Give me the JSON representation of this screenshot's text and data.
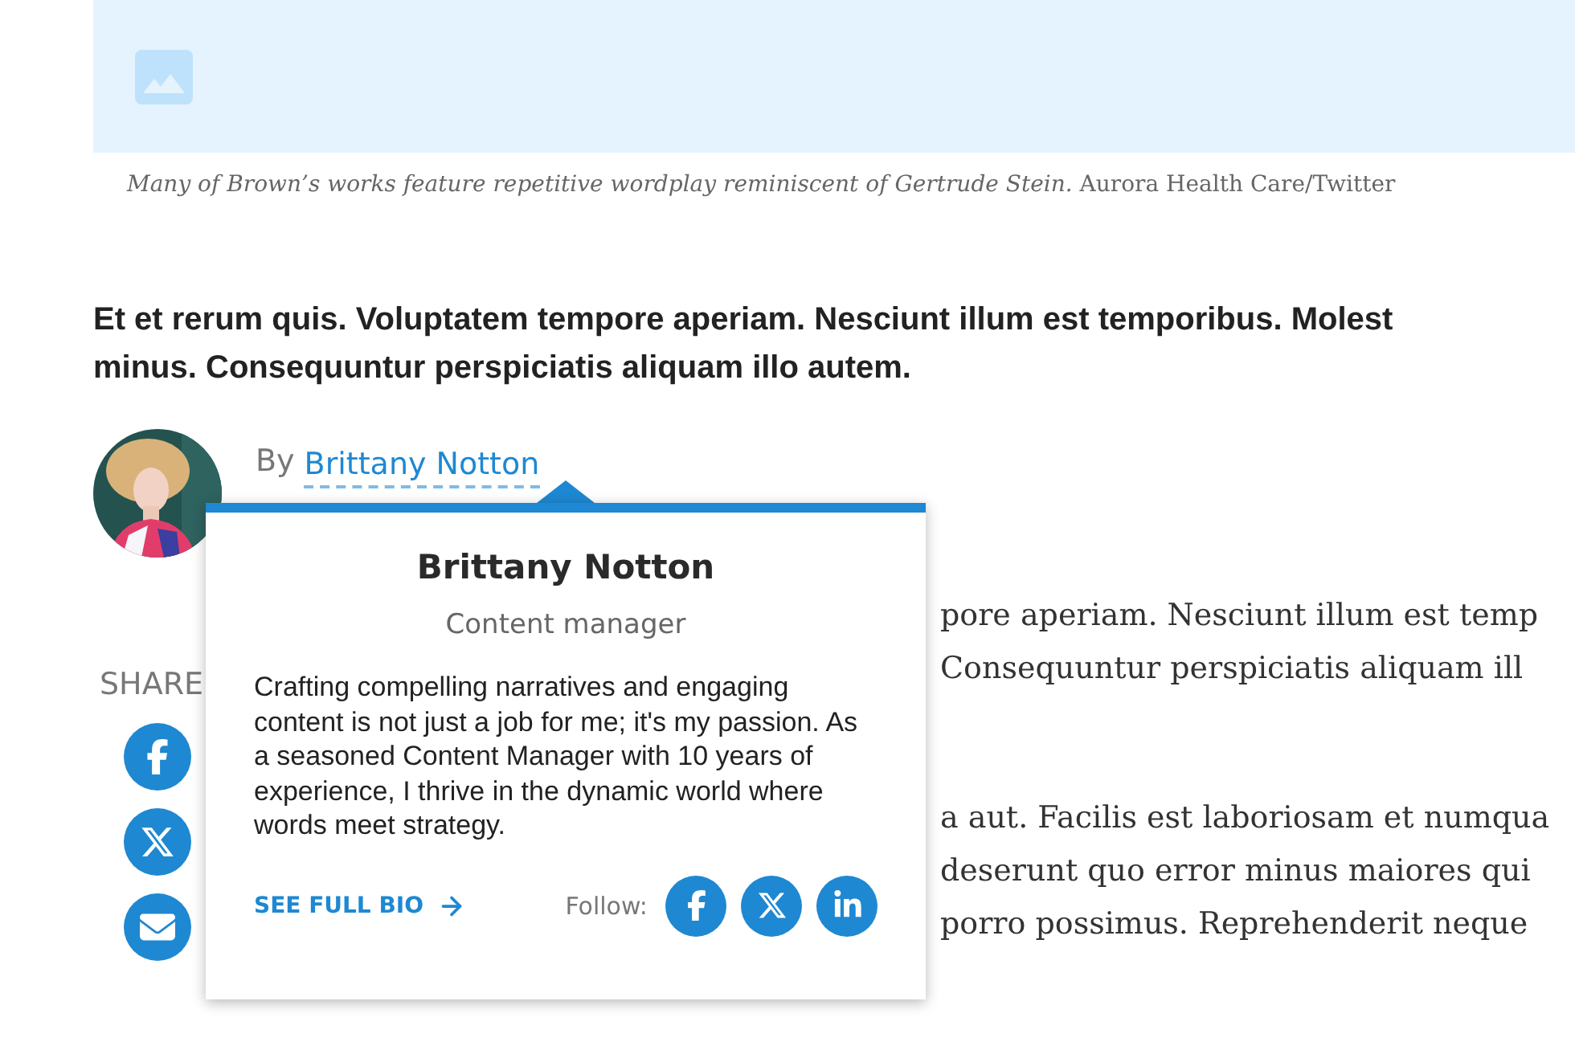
{
  "caption": {
    "text": "Many of Brown’s works feature repetitive wordplay reminiscent of Gertrude Stein.",
    "credit": "Aurora Health Care/Twitter"
  },
  "lead": [
    "Et et rerum quis. Voluptatem tempore aperiam. Nesciunt illum est temporibus. Molest",
    "minus. Consequuntur perspiciatis aliquam illo autem."
  ],
  "byline": {
    "prefix": "By",
    "author": "Brittany Notton"
  },
  "share": {
    "label": "SHARE",
    "buttons": [
      {
        "kind": "facebook"
      },
      {
        "kind": "x"
      },
      {
        "kind": "email"
      }
    ]
  },
  "body_paragraphs": [
    [
      "pore aperiam. Nesciunt illum est temp",
      "Consequuntur perspiciatis aliquam ill"
    ],
    [
      "a aut. Facilis est laboriosam et numqua",
      "deserunt quo error minus maiores qui",
      "porro possimus. Reprehenderit neque"
    ]
  ],
  "author_card": {
    "name": "Brittany Notton",
    "role": "Content manager",
    "bio": "Crafting compelling narratives and engaging content is not just a job for me; it's my passion. As a seasoned Content Manager with 10 years of experience, I thrive in the dynamic world where words meet strategy.",
    "link": "SEE FULL BIO",
    "follow_label": "Follow:",
    "follow": [
      {
        "kind": "facebook"
      },
      {
        "kind": "x"
      },
      {
        "kind": "linkedin"
      }
    ]
  }
}
